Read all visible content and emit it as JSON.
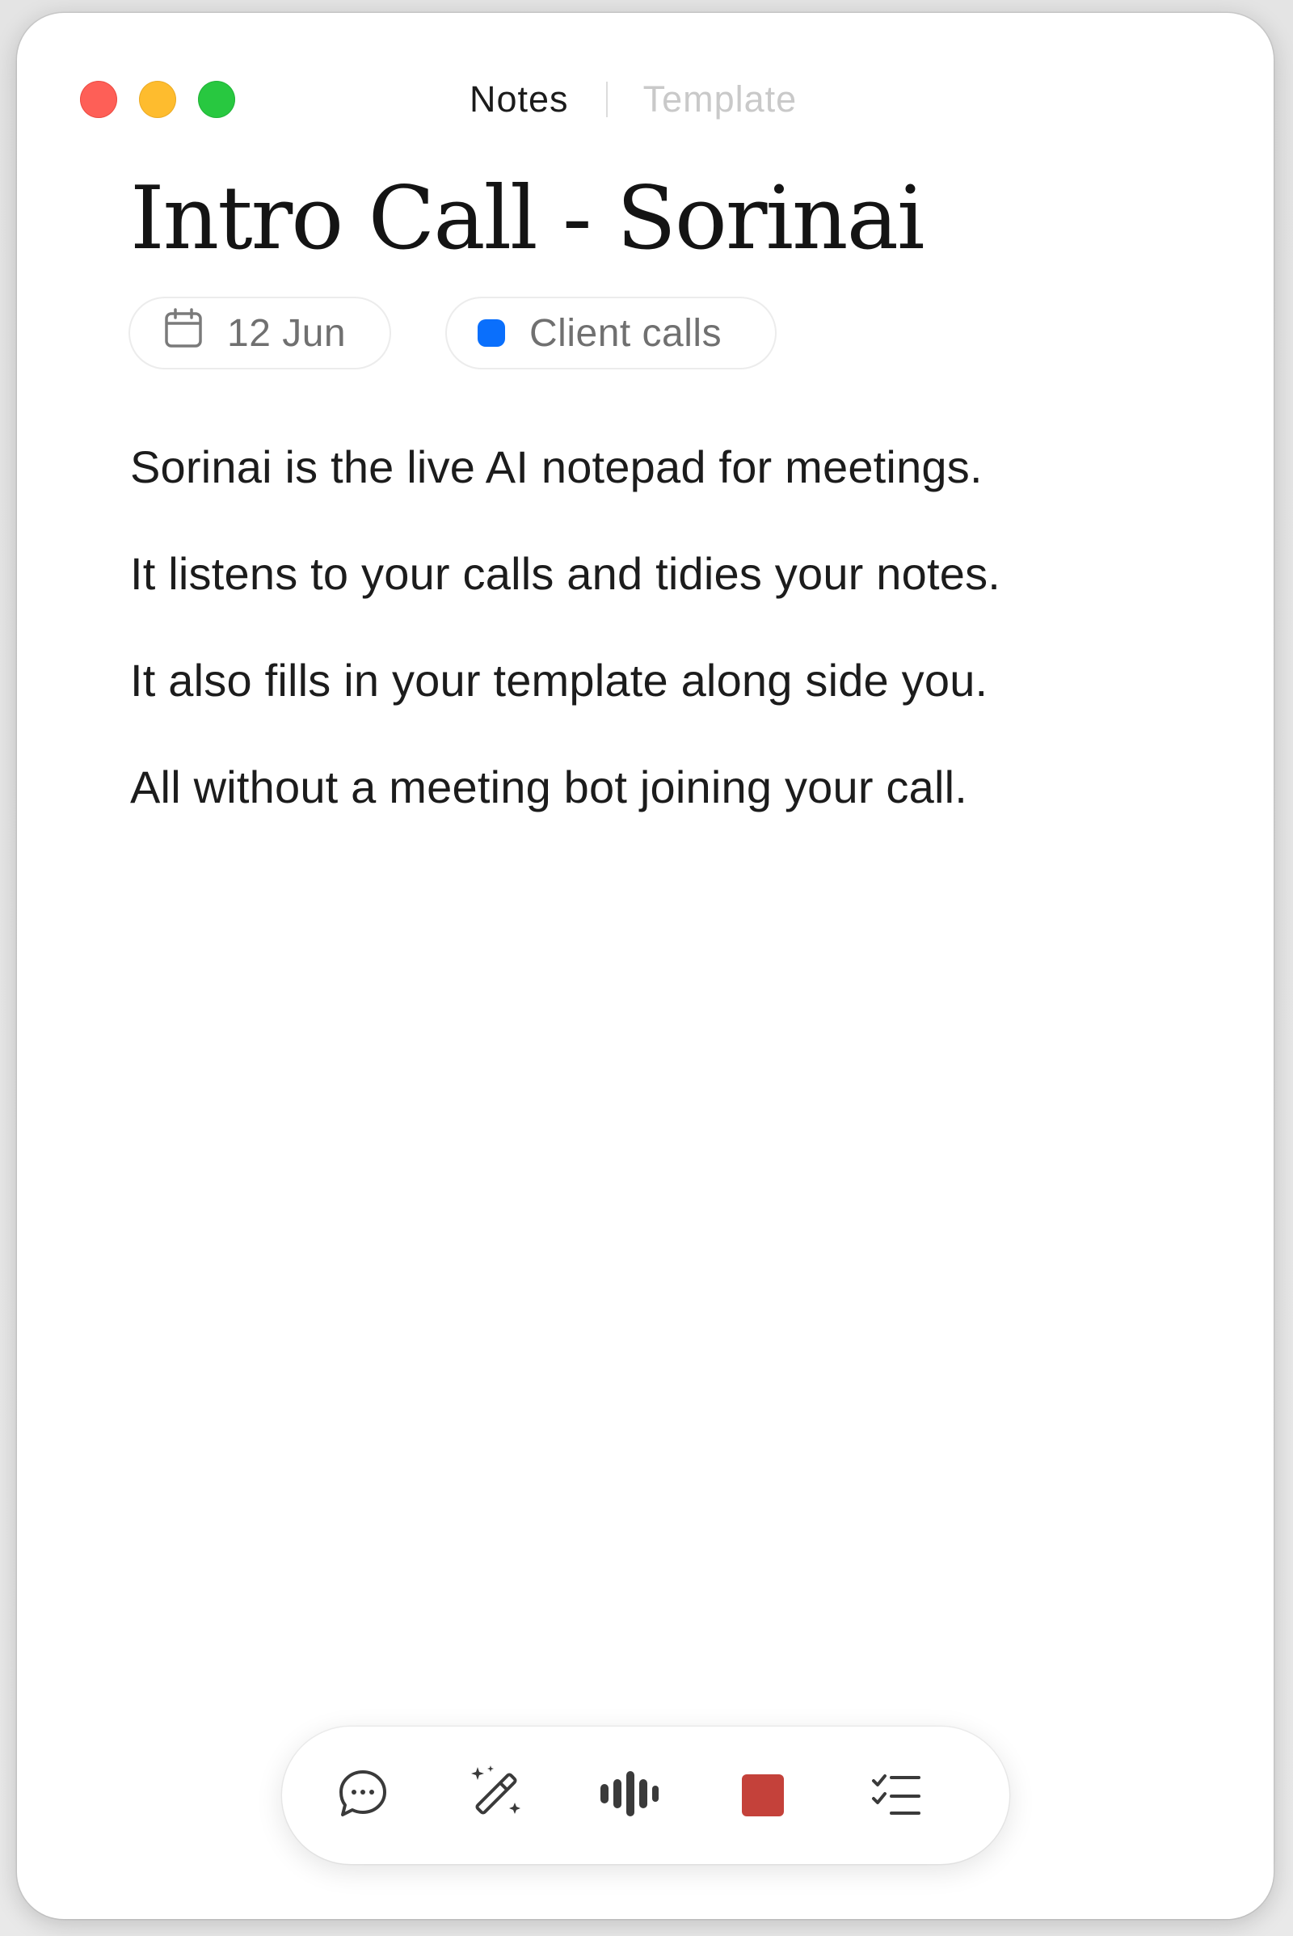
{
  "window": {
    "traffic_lights": {
      "close_color": "#fe5f57",
      "minimize_color": "#febc2e",
      "zoom_color": "#28c840"
    }
  },
  "tabs": {
    "notes_label": "Notes",
    "template_label": "Template",
    "active": "Notes"
  },
  "note": {
    "title": "Intro Call - Sorinai",
    "date": "12 Jun",
    "folder": "Client calls",
    "folder_color": "#0a6ffc",
    "paragraphs": [
      "Sorinai is the live AI notepad for meetings.",
      "It listens to your calls and tidies your notes.",
      "It also fills in your template along side you.",
      "All without a meeting bot joining your call."
    ]
  },
  "toolbar": {
    "icons": [
      "chat-bubble-icon",
      "magic-wand-icon",
      "audio-waveform-icon",
      "stop-recording-icon",
      "checklist-icon"
    ],
    "stop_color": "#c4413a"
  }
}
